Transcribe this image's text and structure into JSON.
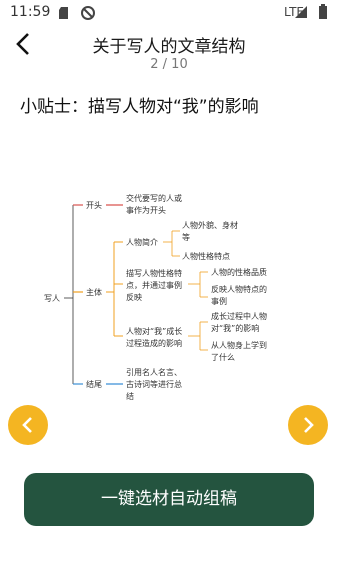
{
  "status": {
    "time": "11:59",
    "network": "LTE"
  },
  "header": {
    "title": "关于写人的文章结构",
    "page_counter": "2 / 10"
  },
  "tip": "小贴士：描写人物对“我”的影响",
  "mindmap": {
    "root": "写人",
    "opening": {
      "label": "开头",
      "desc": [
        "交代要写的人或",
        "事作为开头"
      ]
    },
    "body": {
      "label": "主体",
      "intro": {
        "label": "人物简介",
        "items": [
          [
            "人物外貌、身材",
            "等"
          ],
          [
            "人物性格特点"
          ]
        ]
      },
      "traits": {
        "label": [
          "描写人物性格特",
          "点，并通过事例",
          "反映"
        ],
        "items": [
          [
            "人物的性格品质"
          ],
          [
            "反映人物特点的",
            "事例"
          ]
        ]
      },
      "influence": {
        "label": [
          "人物对“我”成长",
          "过程造成的影响"
        ],
        "items": [
          [
            "成长过程中人物",
            "对“我”的影响"
          ],
          [
            "从人物身上学到",
            "了什么"
          ]
        ]
      }
    },
    "ending": {
      "label": "结尾",
      "desc": [
        "引用名人名言、",
        "古诗词等进行总",
        "结"
      ]
    }
  },
  "cta_label": "一键选材自动组稿",
  "colors": {
    "accent": "#f4b522",
    "cta": "#24543f",
    "branch_opening": "#d9534f",
    "branch_body": "#f0a020",
    "branch_ending": "#3b8fd6"
  }
}
